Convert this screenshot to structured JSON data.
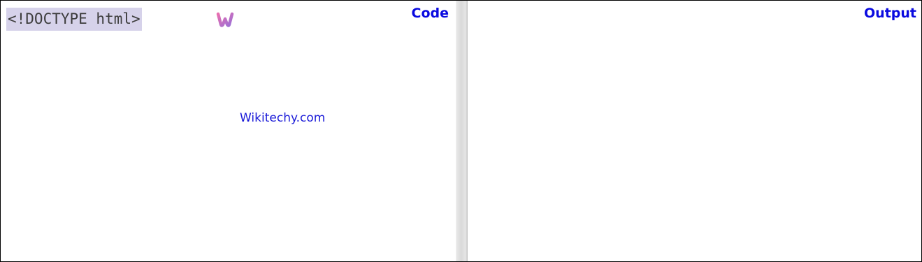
{
  "code_panel": {
    "label": "Code",
    "code_lines": [
      "<!DOCTYPE html>"
    ],
    "logo": {
      "icon": "wikitechy-logo-icon",
      "text": "Wikitechy"
    },
    "watermark": "Wikitechy.com"
  },
  "output_panel": {
    "label": "Output"
  },
  "colors": {
    "label": "#0a0ae0",
    "code_highlight": "#d6d2ea",
    "code_text": "#3d3d3d",
    "watermark": "#1a1ad8",
    "logo_pink": "#e86fb0",
    "logo_violet": "#9a6fd6"
  }
}
